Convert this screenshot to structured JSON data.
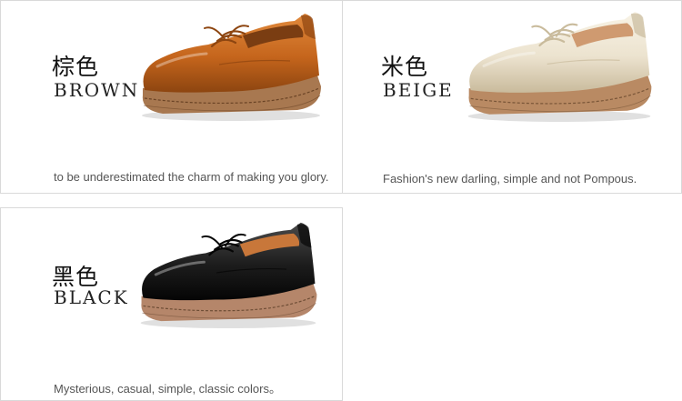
{
  "products": [
    {
      "cn": "棕色",
      "en": "BROWN",
      "tagline": "to be underestimated the charm of making you glory.",
      "upper": "#c5651c",
      "upper_light": "#e18a3d",
      "upper_dark": "#8d4510",
      "lining": "#7a3d12",
      "sole": "#a87850",
      "sole_dark": "#6b4426"
    },
    {
      "cn": "米色",
      "en": "BEIGE",
      "tagline": "Fashion's new darling, simple and not Pompous.",
      "upper": "#ece3cf",
      "upper_light": "#f8f3e6",
      "upper_dark": "#c9bb9c",
      "lining": "#cf9a70",
      "sole": "#b98a63",
      "sole_dark": "#7a5638"
    },
    {
      "cn": "黑色",
      "en": "BLACK",
      "tagline": "Mysterious, casual, simple, classic colors。",
      "upper": "#1c1c1c",
      "upper_light": "#4a4a4a",
      "upper_dark": "#050505",
      "lining": "#c8773a",
      "sole": "#b5866a",
      "sole_dark": "#6e4d35"
    }
  ]
}
